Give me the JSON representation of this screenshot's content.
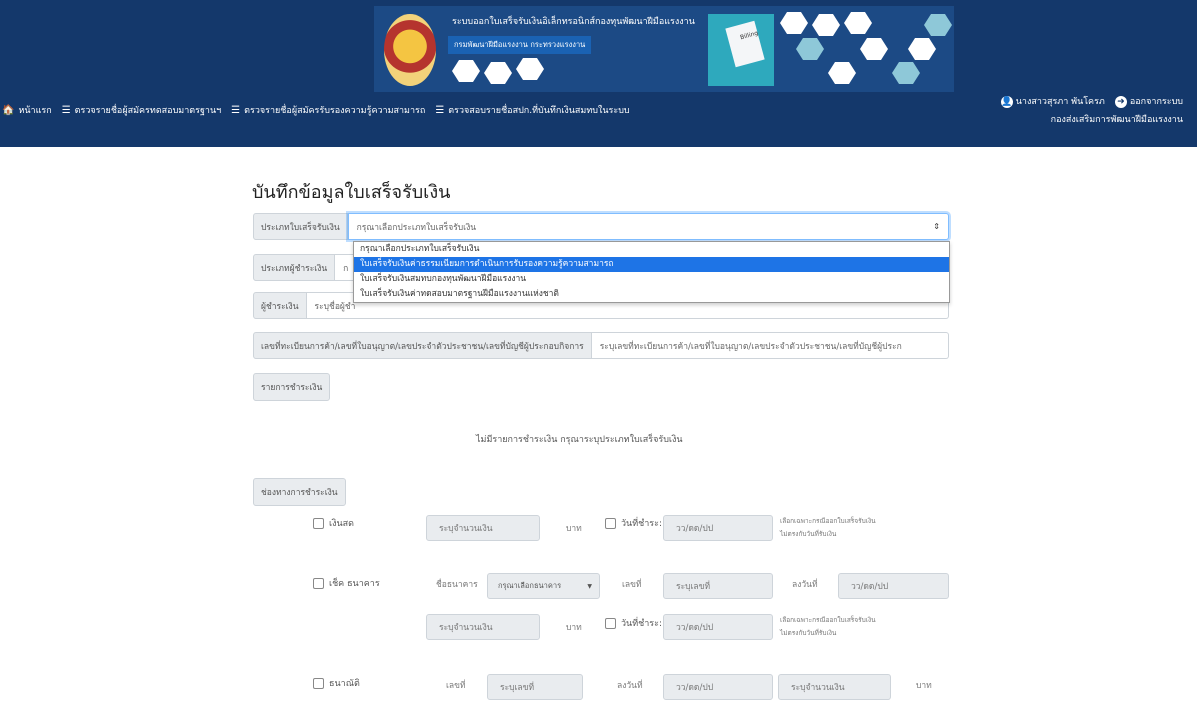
{
  "header": {
    "banner_title": "ระบบออกใบเสร็จรับเงินอิเล็กทรอนิกส์กองทุนพัฒนาฝีมือแรงงาน",
    "banner_subtitle": "กรมพัฒนาฝีมือแรงงาน กระทรวงแรงงาน",
    "bill_label": "Billing"
  },
  "nav": {
    "home": "หน้าแรก",
    "item1": "ตรวจรายชื่อผู้สมัครทดสอบมาตรฐานฯ",
    "item2": "ตรวจรายชื่อผู้สมัครรับรองความรู้ความสามารถ",
    "item3": "ตรวจสอบรายชื่อสปก.ที่บันทึกเงินสมทบในระบบ"
  },
  "user": {
    "name": "นางสาวสุรภา พันโครภ",
    "logout": "ออกจากระบบ",
    "department": "กองส่งเสริมการพัฒนาฝีมือแรงงาน"
  },
  "page_title": "บันทึกข้อมูลใบเสร็จรับเงิน",
  "form": {
    "receipt_type_label": "ประเภทใบเสร็จรับเงิน",
    "receipt_type_value": "กรุณาเลือกประเภทใบเสร็จรับเงิน",
    "receipt_type_options": [
      "กรุณาเลือกประเภทใบเสร็จรับเงิน",
      "ใบเสร็จรับเงินค่าธรรมเนียมการดำเนินการรับรองความรู้ความสามารถ",
      "ใบเสร็จรับเงินสมทบกองทุนพัฒนาฝีมือแรงงาน",
      "ใบเสร็จรับเงินค่าทดสอบมาตรฐานฝีมือแรงงานแห่งชาติ"
    ],
    "payer_type_label": "ประเภทผู้ชำระเงิน",
    "payer_type_value": "ก",
    "payer_label": "ผู้ชำระเงิน",
    "payer_placeholder": "ระบุชื่อผู้ชำ",
    "regno_label": "เลขที่ทะเบียนการค้า/เลขที่ใบอนุญาต/เลขประจำตัวประชาชน/เลขที่บัญชีผู้ประกอบกิจการ",
    "regno_placeholder": "ระบุเลขที่ทะเบียนการค้า/เลขที่ใบอนุญาต/เลขประจำตัวประชาชน/เลขที่บัญชีผู้ประก",
    "payment_items_button": "รายการชำระเงิน",
    "no_items_message": "ไม่มีรายการชำระเงิน กรุณาระบุประเภทใบเสร็จรับเงิน",
    "payment_channel_button": "ช่องทางการชำระเงิน"
  },
  "payment": {
    "cash_label": "เงินสด",
    "amount_placeholder": "ระบุจำนวนเงิน",
    "baht": "บาท",
    "pay_date_label": "วันที่ชำระ:",
    "date_placeholder": "วว/ดด/ปป",
    "note_line1": "เลือกเฉพาะกรณีออกใบเสร็จรับเงิน",
    "note_line2": "ไม่ตรงกับวันที่รับเงิน",
    "cheque_label": "เช็ค ธนาคาร",
    "bank_name_label": "ชื่อธนาคาร",
    "bank_select": "กรุณาเลือกธนาคาร",
    "number_label": "เลขที่",
    "number_placeholder": "ระบุเลขที่",
    "dated_label": "ลงวันที่",
    "money_order_label": "ธนาณัติ"
  },
  "colors": {
    "header_bg": "#14386b",
    "selected_option": "#1e74e6"
  }
}
